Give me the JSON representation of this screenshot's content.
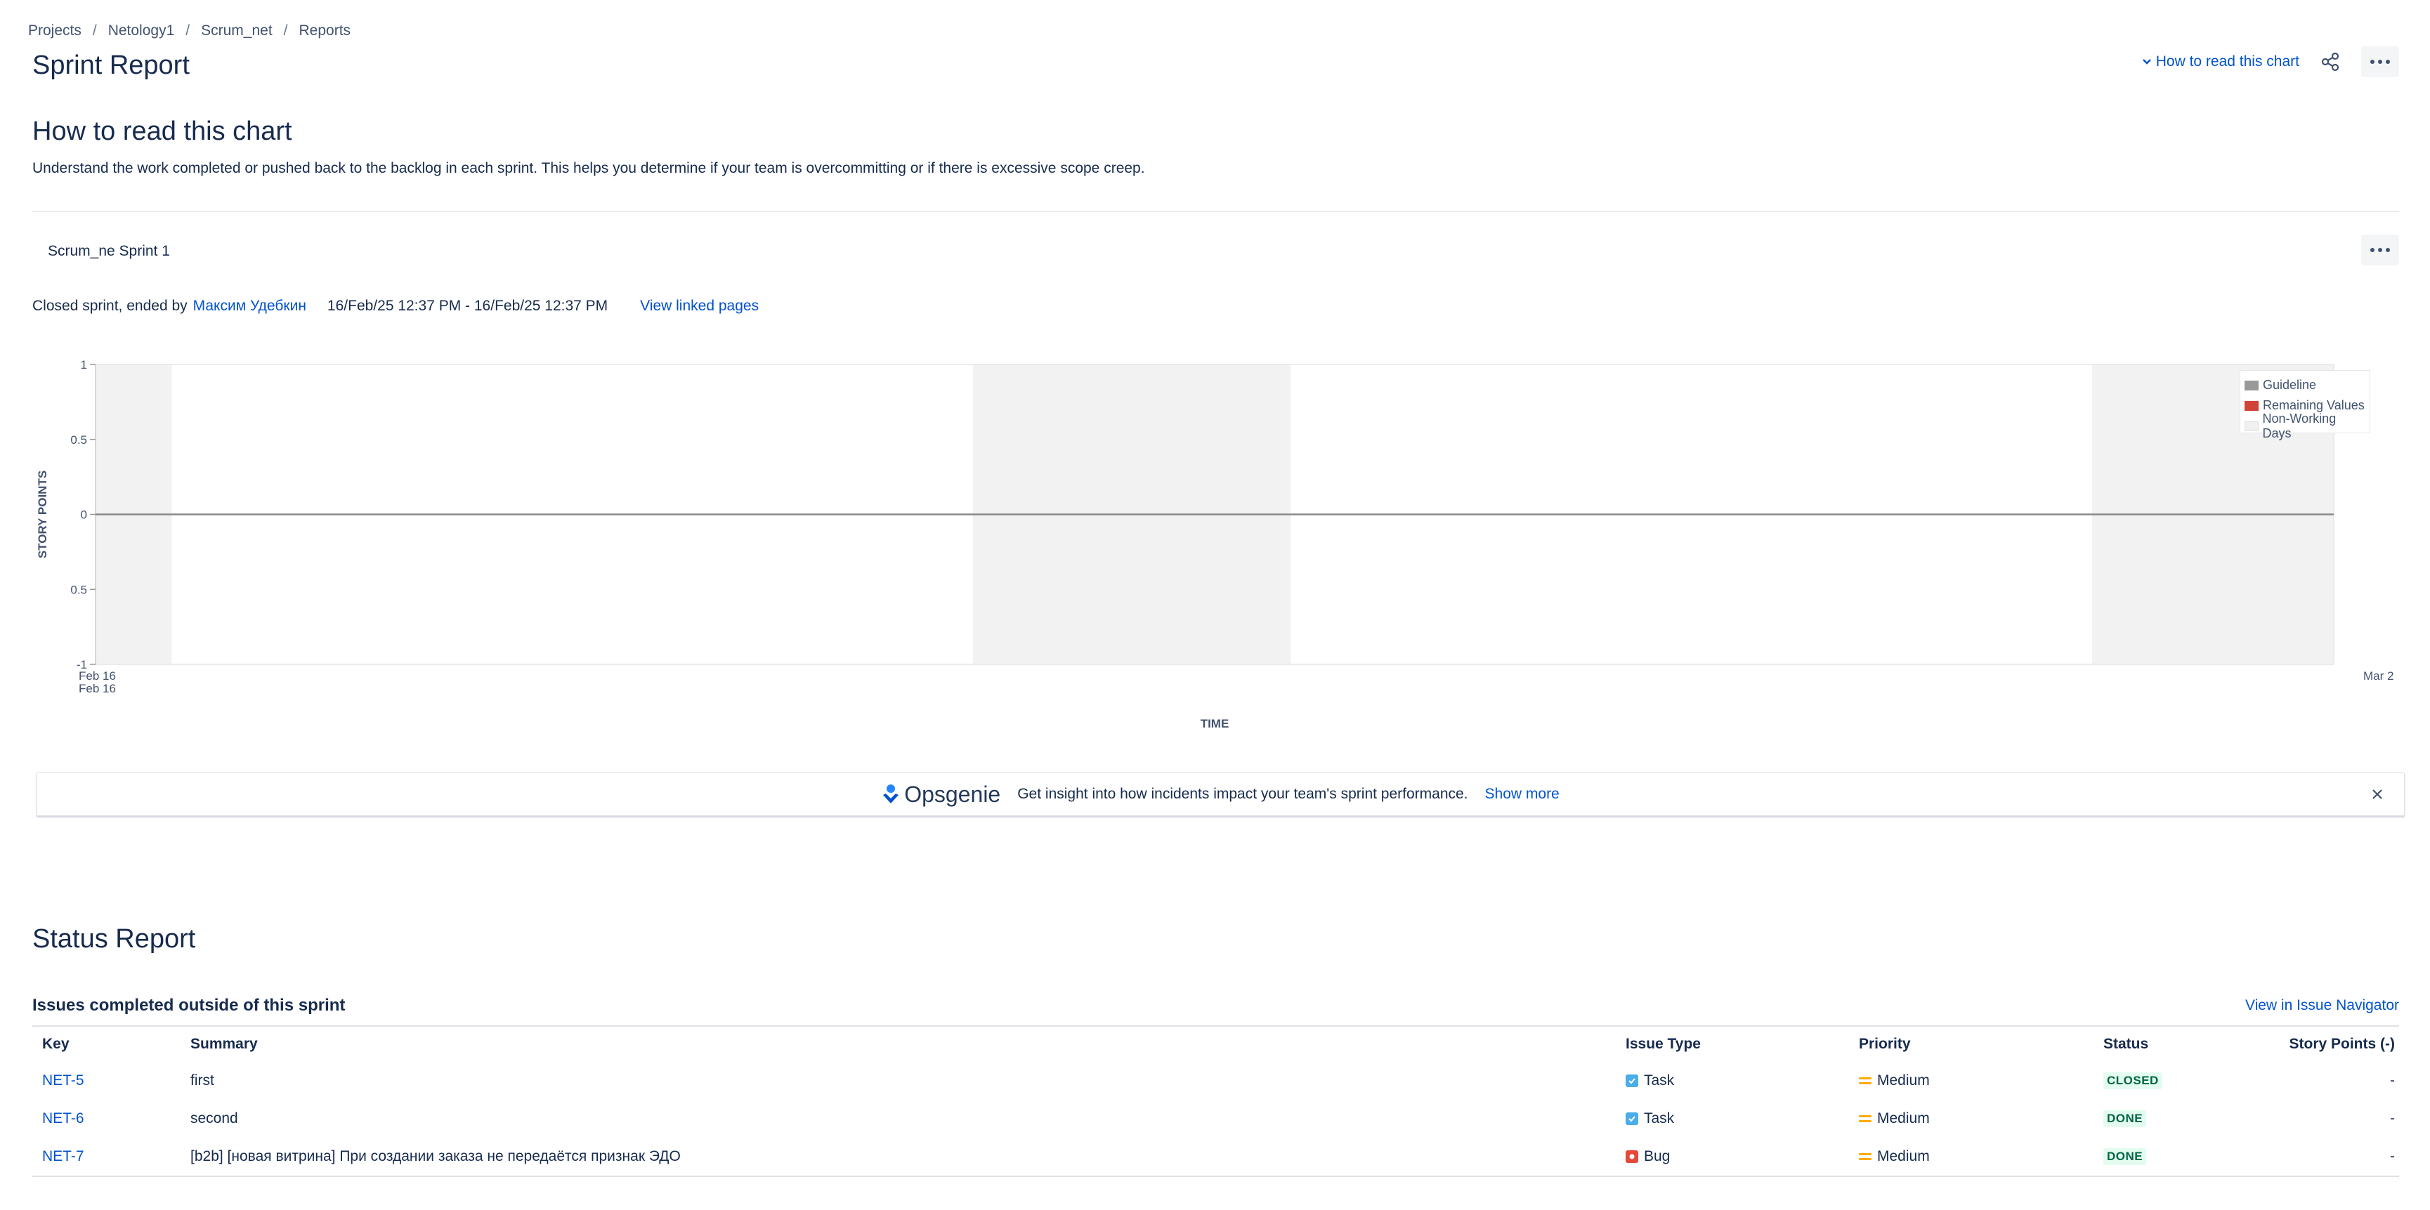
{
  "breadcrumb": [
    "Projects",
    "Netology1",
    "Scrum_net",
    "Reports"
  ],
  "page_title": "Sprint Report",
  "header_actions": {
    "how_to_read": "How to read this chart"
  },
  "how_to_read": {
    "title": "How to read this chart",
    "description": "Understand the work completed or pushed back to the backlog in each sprint. This helps you determine if your team is overcommitting or if there is excessive scope creep."
  },
  "sprint": {
    "name": "Scrum_ne Sprint 1",
    "status_text": "Closed sprint, ended by",
    "ended_by": "Максим Удебкин",
    "dates": "16/Feb/25 12:37 PM - 16/Feb/25 12:37 PM",
    "linked_pages": "View linked pages"
  },
  "chart_data": {
    "type": "line",
    "title": "",
    "xlabel": "TIME",
    "ylabel": "STORY POINTS",
    "y_ticks": [
      "1",
      "0.5",
      "0",
      "0.5",
      "-1"
    ],
    "ylim": [
      -1,
      1
    ],
    "x_tick_labels": [
      {
        "label": "Feb 16",
        "sub": "Feb 16"
      },
      {
        "label": "Mar 2",
        "sub": ""
      }
    ],
    "x_start": "Feb 16",
    "x_end": "Mar 2",
    "series": [
      {
        "name": "Guideline",
        "color": "#999999",
        "values": [
          0,
          0
        ]
      },
      {
        "name": "Remaining Values",
        "color": "#d04437",
        "values": []
      },
      {
        "name": "Non-Working Days",
        "color": "#f0f0f0",
        "values": []
      }
    ],
    "non_working_bands": [
      [
        0,
        0.034
      ],
      [
        0.392,
        0.534
      ],
      [
        0.892,
        1.0
      ]
    ],
    "grid": true,
    "legend_position": "top-right"
  },
  "banner": {
    "brand": "Opsgenie",
    "text": "Get insight into how incidents impact your team's sprint performance.",
    "link": "Show more"
  },
  "status_report": {
    "title": "Status Report",
    "section_title": "Issues completed outside of this sprint",
    "navigator_link": "View in Issue Navigator",
    "columns": [
      "Key",
      "Summary",
      "Issue Type",
      "Priority",
      "Status",
      "Story Points (-)"
    ],
    "rows": [
      {
        "key": "NET-5",
        "summary": "first",
        "type": "Task",
        "priority": "Medium",
        "status": "CLOSED",
        "points": "-"
      },
      {
        "key": "NET-6",
        "summary": "second",
        "type": "Task",
        "priority": "Medium",
        "status": "DONE",
        "points": "-"
      },
      {
        "key": "NET-7",
        "summary": "[b2b] [новая витрина] При создании заказа не передаётся признак ЭДО",
        "type": "Bug",
        "priority": "Medium",
        "status": "DONE",
        "points": "-"
      }
    ]
  }
}
